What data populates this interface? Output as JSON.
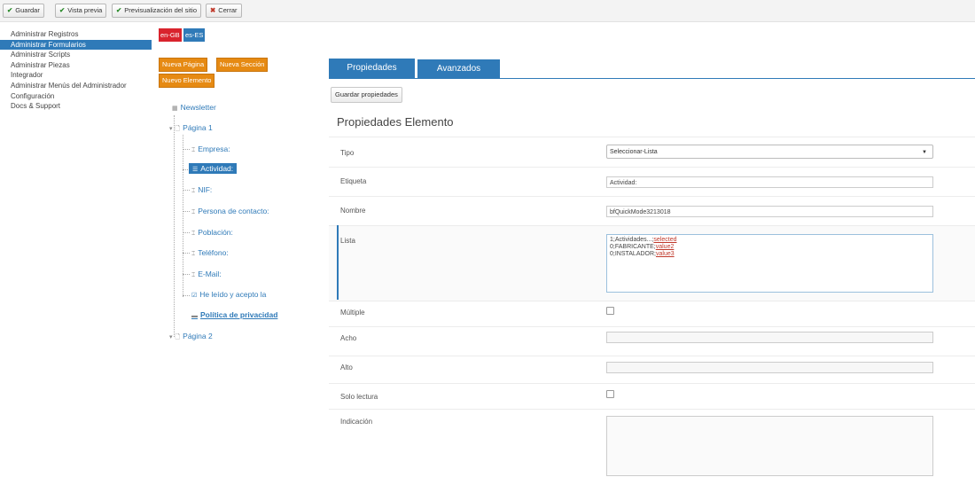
{
  "toolbar": {
    "guardar": "Guardar",
    "vista_previa": "Vista previa",
    "previsualizacion": "Previsualización del sitio",
    "cerrar": "Cerrar"
  },
  "sidebar": {
    "items": [
      {
        "label": "Administrar Registros"
      },
      {
        "label": "Administrar Formularios"
      },
      {
        "label": "Administrar Scripts"
      },
      {
        "label": "Administrar Piezas"
      },
      {
        "label": "Integrador"
      },
      {
        "label": "Administrar Menús del Administrador"
      },
      {
        "label": "Configuración"
      },
      {
        "label": "Docs & Support"
      }
    ]
  },
  "languages": {
    "en": "en-GB",
    "es": "es-ES"
  },
  "builder": {
    "nueva_pagina": "Nueva Página",
    "nueva_seccion": "Nueva Sección",
    "nuevo_elemento": "Nuevo Elemento"
  },
  "tree": {
    "root": "Newsletter",
    "page1": "Página 1",
    "elements": [
      {
        "label": "Empresa:"
      },
      {
        "label": "Actividad:"
      },
      {
        "label": "NIF:"
      },
      {
        "label": "Persona de contacto:"
      },
      {
        "label": "Población:"
      },
      {
        "label": "Teléfono:"
      },
      {
        "label": "E-Mail:"
      },
      {
        "label": "He leído y acepto la"
      }
    ],
    "section": "Política de privacidad",
    "page2": "Página 2"
  },
  "tabs": {
    "propiedades": "Propiedades",
    "avanzados": "Avanzados"
  },
  "panel": {
    "guardar_propiedades": "Guardar propiedades",
    "title": "Propiedades Elemento"
  },
  "props": {
    "tipo": {
      "label": "Tipo",
      "value": "Seleccionar-Lista"
    },
    "etiqueta": {
      "label": "Etiqueta",
      "value": "Actividad:"
    },
    "nombre": {
      "label": "Nombre",
      "value": "bfQuickMode3213018"
    },
    "lista": {
      "label": "Lista",
      "lines": [
        {
          "a": "1;Actividades...;",
          "b": "selected"
        },
        {
          "a": "0;FABRICANTE;",
          "b": "value2"
        },
        {
          "a": "0;INSTALADOR;",
          "b": "value3"
        }
      ]
    },
    "multiple": {
      "label": "Múltiple",
      "checked": false
    },
    "ancho": {
      "label": "Acho",
      "value": ""
    },
    "alto": {
      "label": "Alto",
      "value": ""
    },
    "solo_lectura": {
      "label": "Solo lectura",
      "checked": false
    },
    "indicacion": {
      "label": "Indicación",
      "value": ""
    }
  },
  "colors": {
    "accent": "#2f7ab8",
    "orange": "#e68a13",
    "flag_en": "#d9232d",
    "flag_es": "#2f7ab8"
  },
  "icons": [
    "check-icon",
    "close-circle-icon",
    "form-icon",
    "page-icon",
    "textfield-icon",
    "select-icon",
    "checkbox-icon",
    "folder-icon",
    "chevron-down-icon"
  ]
}
